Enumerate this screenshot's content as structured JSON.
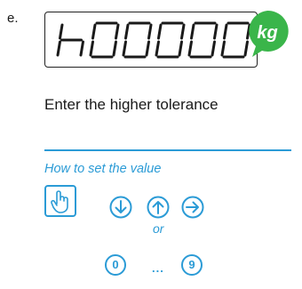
{
  "step": {
    "letter": "e."
  },
  "display": {
    "reading": "h00000",
    "unit": "kg"
  },
  "instruction": "Enter the higher tolerance",
  "howto": {
    "title": "How to set the value",
    "touch_icon": "touch-key-icon",
    "nav_icons": [
      "arrow-down-icon",
      "arrow-up-icon",
      "arrow-right-icon"
    ],
    "or_label": "or",
    "digit_start": "0",
    "digit_ellipsis": "...",
    "digit_end": "9"
  },
  "colors": {
    "accent": "#2b9bd6",
    "unit_badge": "#3ab54a",
    "text": "#1a1a1a"
  }
}
